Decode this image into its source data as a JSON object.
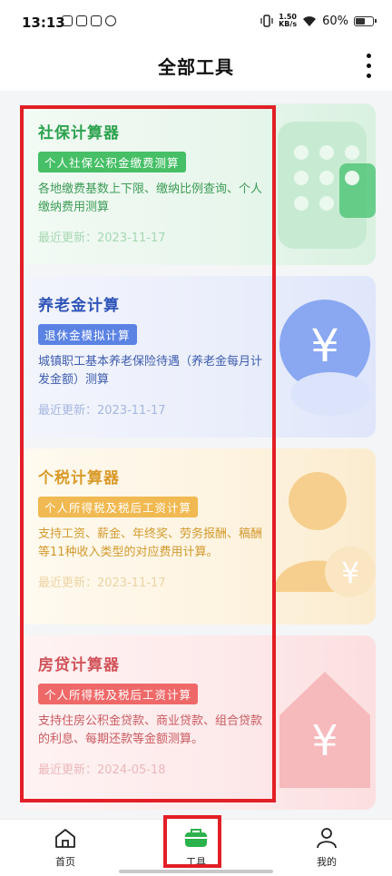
{
  "status_bar": {
    "time": "13:13",
    "speed_value": "1.50",
    "speed_unit": "KB/s",
    "battery": "60%",
    "battery_level": 0.6
  },
  "header": {
    "title": "全部工具"
  },
  "cards": [
    {
      "title": "社保计算器",
      "tag": "个人社保公积金缴费测算",
      "desc": "各地缴费基数上下限、缴纳比例查询、个人缴纳费用测算",
      "updated": "最近更新：2023-11-17"
    },
    {
      "title": "养老金计算",
      "tag": "退休金模拟计算",
      "desc": "城镇职工基本养老保险待遇（养老金每月计发金额）测算",
      "updated": "最近更新：2023-11-17"
    },
    {
      "title": "个税计算器",
      "tag": "个人所得税及税后工资计算",
      "desc": "支持工资、薪金、年终奖、劳务报酬、稿酬等11种收入类型的对应费用计算。",
      "updated": "最近更新：2023-11-17"
    },
    {
      "title": "房贷计算器",
      "tag": "个人所得税及税后工资计算",
      "desc": "支持住房公积金贷款、商业贷款、组合贷款的利息、每期还款等金额测算。",
      "updated": "最近更新：2024-05-18"
    }
  ],
  "art_symbols": {
    "yen": "¥"
  },
  "bottom_nav": {
    "home": "首页",
    "tools": "工具",
    "me": "我的"
  },
  "colors": {
    "highlight": "#e21f26",
    "green": "#2ca24e",
    "blue": "#2f54b8",
    "orange": "#d99a29",
    "red": "#d2535a"
  }
}
